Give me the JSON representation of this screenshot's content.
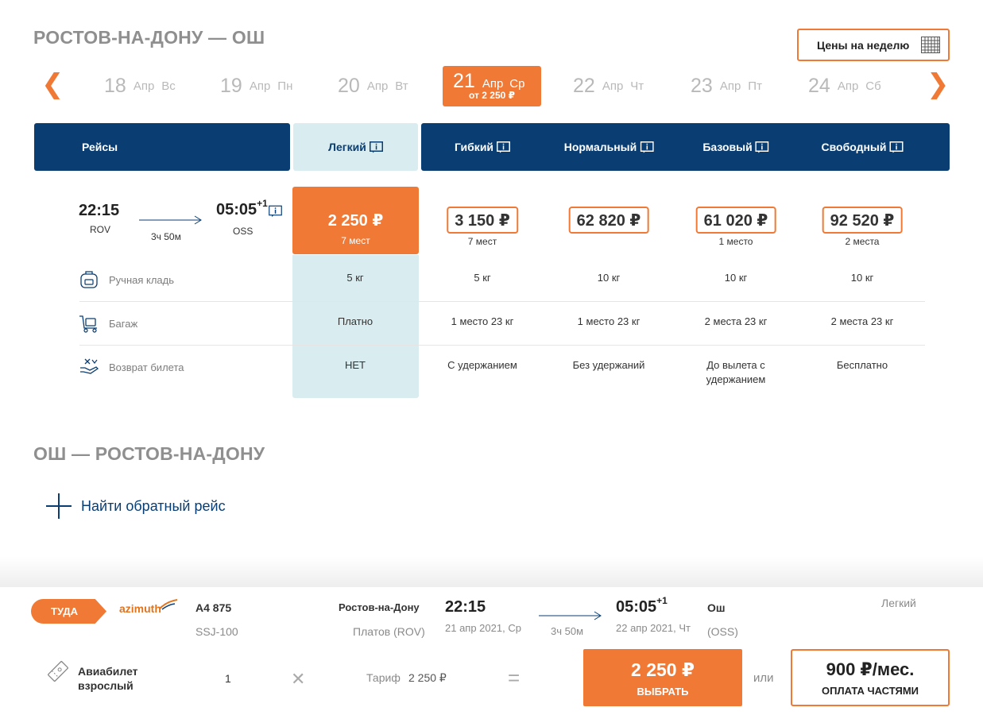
{
  "outbound": {
    "title": "РОСТОВ-НА-ДОНУ — ОШ",
    "week_button": "Цены на неделю"
  },
  "dates": [
    {
      "num": "18",
      "month": "Апр",
      "dow": "Вс"
    },
    {
      "num": "19",
      "month": "Апр",
      "dow": "Пн"
    },
    {
      "num": "20",
      "month": "Апр",
      "dow": "Вт"
    },
    {
      "num": "21",
      "month": "Апр",
      "dow": "Ср",
      "price": "от 2 250 ₽"
    },
    {
      "num": "22",
      "month": "Апр",
      "dow": "Чт"
    },
    {
      "num": "23",
      "month": "Апр",
      "dow": "Пт"
    },
    {
      "num": "24",
      "month": "Апр",
      "dow": "Сб"
    }
  ],
  "nav": {
    "prev": "❮",
    "next": "❯"
  },
  "table": {
    "flights_header": "Рейсы",
    "tariffs": [
      "Легкий",
      "Гибкий",
      "Нормальный",
      "Базовый",
      "Свободный"
    ]
  },
  "flight": {
    "dep_time": "22:15",
    "dep_code": "ROV",
    "duration": "3ч 50м",
    "arr_time": "05:05",
    "arr_plus": "+1",
    "arr_code": "OSS"
  },
  "prices": [
    {
      "price": "2 250 ₽",
      "seats": "7 мест"
    },
    {
      "price": "3 150 ₽",
      "seats": "7 мест"
    },
    {
      "price": "62 820 ₽",
      "seats": ""
    },
    {
      "price": "61 020 ₽",
      "seats": "1 место"
    },
    {
      "price": "92 520 ₽",
      "seats": "2 места"
    }
  ],
  "rows": [
    {
      "label": "Ручная кладь",
      "icon": "backpack-icon",
      "values": [
        "5 кг",
        "5 кг",
        "10 кг",
        "10 кг",
        "10 кг"
      ]
    },
    {
      "label": "Багаж",
      "icon": "luggage-cart-icon",
      "values": [
        "Платно",
        "1 место 23 кг",
        "1 место 23 кг",
        "2 места 23 кг",
        "2 места 23 кг"
      ]
    },
    {
      "label": "Возврат билета",
      "icon": "refund-hand-icon",
      "values": [
        "НЕТ",
        "С удержанием",
        "Без удержаний",
        "До вылета с",
        "Бесплатно"
      ],
      "extra": "удержанием"
    }
  ],
  "return": {
    "title": "ОШ — РОСТОВ-НА-ДОНУ",
    "find_label": "Найти обратный рейс"
  },
  "summary": {
    "direction": "ТУДА",
    "airline_logo": "azimuth",
    "flight_no": "А4 875",
    "aircraft": "SSJ-100",
    "from_city": "Ростов-на-Дону",
    "from_airport": "Платов (ROV)",
    "dep_time": "22:15",
    "dep_date": "21 апр 2021, Ср",
    "duration": "3ч 50м",
    "arr_time": "05:05",
    "arr_plus": "+1",
    "arr_date": "22 апр 2021, Чт",
    "to_city": "Ош",
    "to_airport": "(OSS)",
    "tariff_name": "Легкий",
    "ticket_type_1": "Авиабилет",
    "ticket_type_2": "взрослый",
    "count": "1",
    "times": "✕",
    "tariff_label": "Тариф",
    "tariff_value": "2 250 ₽",
    "equals": "=",
    "total": "2 250 ₽",
    "select_label": "ВЫБРАТЬ",
    "or": "или",
    "monthly": "900 ₽/мес.",
    "parts_label": "ОПЛАТА ЧАСТЯМИ"
  },
  "colors": {
    "accent": "#f07a35",
    "navy": "#0a3e73",
    "light_col": "#d9ecef"
  }
}
